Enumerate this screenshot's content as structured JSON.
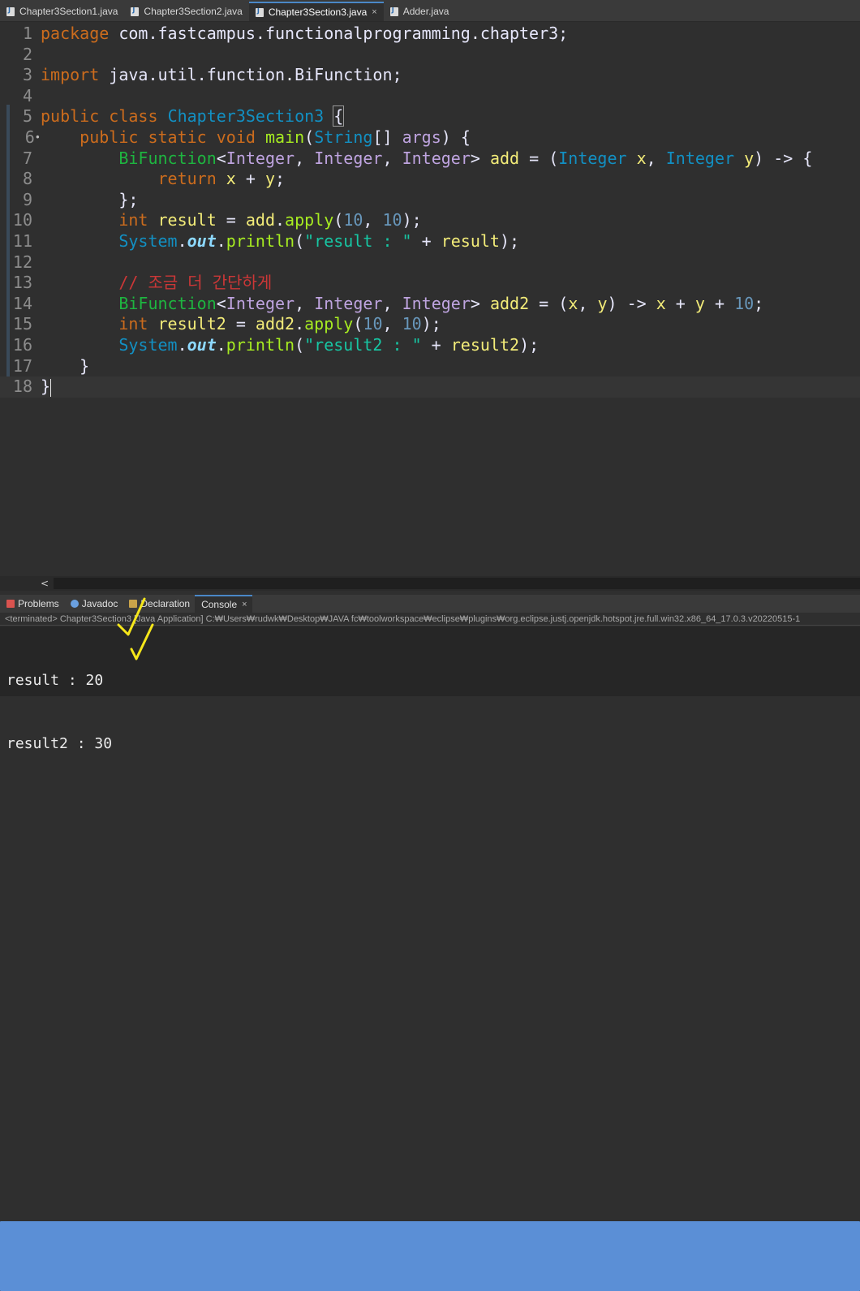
{
  "editor_tabs": [
    {
      "label": "Chapter3Section1.java",
      "active": false,
      "closable": false
    },
    {
      "label": "Chapter3Section2.java",
      "active": false,
      "closable": false
    },
    {
      "label": "Chapter3Section3.java",
      "active": true,
      "closable": true
    },
    {
      "label": "Adder.java",
      "active": false,
      "closable": false
    }
  ],
  "tab_close_glyph": "×",
  "code": {
    "line_numbers": [
      "1",
      "2",
      "3",
      "4",
      "5",
      "6",
      "7",
      "8",
      "9",
      "10",
      "11",
      "12",
      "13",
      "14",
      "15",
      "16",
      "17",
      "18"
    ],
    "current_line": 18,
    "tokens": {
      "package_kw": "package",
      "package_name": " com.fastcampus.functionalprogramming.chapter3;",
      "import_kw": "import",
      "import_name": " java.util.function.BiFunction;",
      "public_kw": "public",
      "class_kw": "class",
      "class_name": "Chapter3Section3",
      "open_brace_boxed": "{",
      "static_kw": "static",
      "void_kw": "void",
      "main_name": "main",
      "string_type": "String",
      "args_name": "args",
      "bifunction": "BiFunction",
      "integer_type": "Integer",
      "add_var": "add",
      "x_var": "x",
      "y_var": "y",
      "return_kw": "return",
      "int_kw": "int",
      "result_var": "result",
      "apply_method": "apply",
      "num_10": "10",
      "system_cls": "System",
      "out_field": "out",
      "println_method": "println",
      "str_result": "\"result : \"",
      "comment_korean": "// 조금 더 간단하게",
      "add2_var": "add2",
      "result2_var": "result2",
      "str_result2": "\"result2 : \"",
      "annotation_marker": "•"
    }
  },
  "scrollbar": {
    "left_arrow": "<"
  },
  "views": {
    "tabs": [
      {
        "label": "Problems",
        "icon": "problems-icon",
        "active": false
      },
      {
        "label": "Javadoc",
        "icon": "javadoc-icon",
        "active": false
      },
      {
        "label": "Declaration",
        "icon": "declaration-icon",
        "active": false
      },
      {
        "label": "Console",
        "icon": "console-icon",
        "active": true
      }
    ],
    "close_glyph": "×"
  },
  "console": {
    "status": "<terminated> Chapter3Section3 [Java Application] C:₩Users₩rudwk₩Desktop₩JAVA fc₩toolworkspace₩eclipse₩plugins₩org.eclipse.justj.openjdk.hotspot.jre.full.win32.x86_64_17.0.3.v20220515-1",
    "output_lines": [
      "result : 20",
      "result2 : 30"
    ]
  },
  "annotations": {
    "check_color": "#f5e61a",
    "count": 2
  },
  "colors": {
    "background": "#2f2f2f",
    "keyword": "#cc6c1d",
    "type": "#1290c3",
    "class": "#1eb540",
    "generic": "#bfa4e0",
    "variable": "#f3ec79",
    "method": "#a7ec21",
    "string": "#17c6a3",
    "number": "#6897bb",
    "comment": "#cc3737",
    "active_tab_accent": "#4a88c7"
  }
}
